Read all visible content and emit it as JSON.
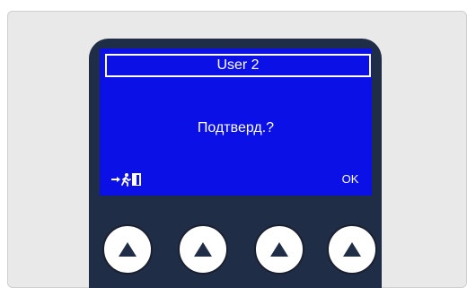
{
  "device": {
    "title": "User 2",
    "message": "Подтверд.?",
    "left_softkey_icon": "exit-run-icon",
    "right_softkey_label": "OK",
    "screen_color": "#0a10e6",
    "frame_color": "#1f2d46"
  },
  "softkeys": [
    {
      "icon": "triangle-up-icon"
    },
    {
      "icon": "triangle-up-icon"
    },
    {
      "icon": "triangle-up-icon"
    },
    {
      "icon": "triangle-up-icon"
    }
  ]
}
